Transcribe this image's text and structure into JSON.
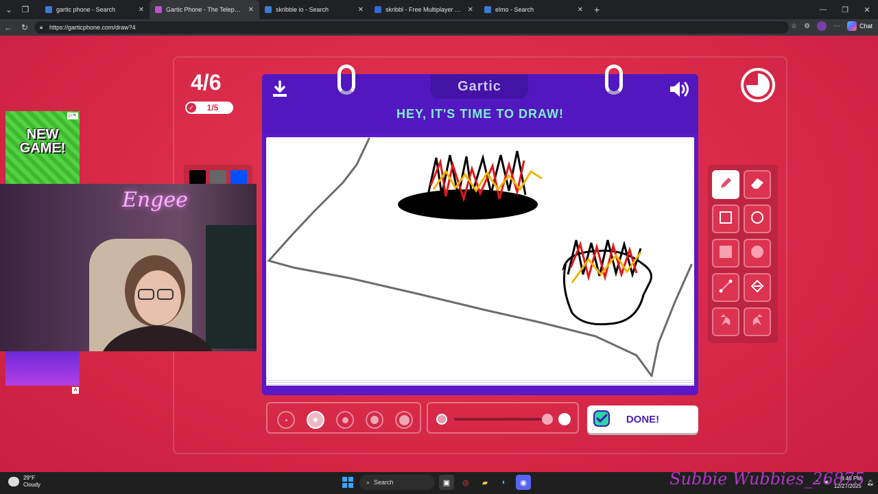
{
  "browser": {
    "tabs": [
      {
        "title": "gartic phone - Search",
        "favicon_color": "#3a7bd5",
        "active": false
      },
      {
        "title": "Gartic Phone - The Telephone Game",
        "favicon_color": "#c24fd6",
        "active": true
      },
      {
        "title": "skribble io - Search",
        "favicon_color": "#3a7bd5",
        "active": false
      },
      {
        "title": "skribbl - Free Multiplayer Drawing",
        "favicon_color": "#2f6bd8",
        "active": false
      },
      {
        "title": "elmo - Search",
        "favicon_color": "#3a7bd5",
        "active": false
      }
    ],
    "url": "https://garticphone.com/draw?4",
    "chat_label": "Chat"
  },
  "game": {
    "round": "4/6",
    "players_done": "1/5",
    "logo": "Gartic",
    "prompt": "HEY, IT'S TIME TO DRAW!",
    "done_label": "DONE!",
    "colors": [
      "#000000",
      "#666666",
      "#0050ff"
    ],
    "tools": [
      "pencil",
      "eraser",
      "rectangle-outline",
      "ellipse-outline",
      "rectangle-filled",
      "ellipse-filled",
      "line",
      "fill-bucket",
      "undo",
      "redo"
    ],
    "selected_tool": "pencil",
    "brush_sizes": 5,
    "selected_size_index": 1,
    "opacity_level": 1.0
  },
  "overlays": {
    "ad_text": "NEW GAME!",
    "ad_badge": "A",
    "webcam_sign": "Engee",
    "watermark": "Subbie Wubbies_26875"
  },
  "taskbar": {
    "temperature": "29°F",
    "condition": "Cloudy",
    "search_label": "Search",
    "time": "8:46 PM",
    "date": "12/27/2025"
  }
}
